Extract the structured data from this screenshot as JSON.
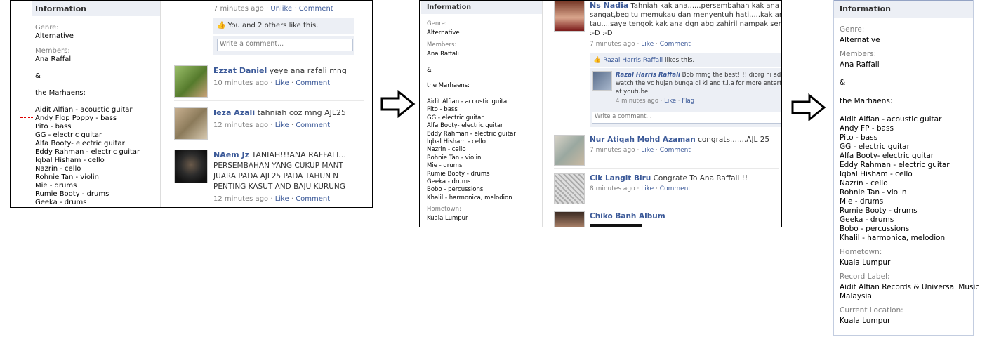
{
  "panel1": {
    "sidebar": {
      "header": "Information",
      "genre_label": "Genre:",
      "genre_value": "Alternative",
      "members_label": "Members:",
      "members_value": "Ana Raffali",
      "ampersand": "&",
      "marhaens": "the Marhaens:",
      "members": [
        "Aidit Alfian - acoustic guitar",
        "Andy Flop Poppy - bass",
        "Pito - bass",
        "GG - electric guitar",
        "Alfa Booty- electric guitar",
        "Eddy Rahman - electric guitar",
        "Iqbal Hisham - cello",
        "Nazrin - cello",
        "Rohnie Tan - violin",
        "Mie - drums",
        "Rumie Booty - drums",
        "Geeka - drums"
      ]
    },
    "feed": {
      "top_time": "7 minutes ago",
      "top_unlike": "Unlike",
      "top_comment": "Comment",
      "likes": "You and 2 others like this.",
      "write_comment": "Write a comment...",
      "posts": [
        {
          "name": "Ezzat Daniel",
          "text": "yeye ana rafali mng",
          "time": "10 minutes ago",
          "like": "Like",
          "comment": "Comment"
        },
        {
          "name": "Ieza Azali",
          "text": "tahniah coz mng AJL25",
          "time": "12 minutes ago",
          "like": "Like",
          "comment": "Comment"
        },
        {
          "name": "NAem Jz",
          "text": "TANIAH!!!ANA RAFFALI...",
          "text2": "PERSEMBAHAN YANG CUKUP MANT",
          "text3": "JUARA PADA AJL25 PADA TAHUN N",
          "text4": "PENTING KASUT AND BAJU KURUNG",
          "time": "12 minutes ago",
          "like": "Like",
          "comment": "Comment"
        }
      ]
    }
  },
  "panel2": {
    "sidebar": {
      "header": "Information",
      "genre_label": "Genre:",
      "genre_value": "Alternative",
      "members_label": "Members:",
      "members_value": "Ana Raffali",
      "ampersand": "&",
      "marhaens": "the Marhaens:",
      "members": [
        "Aidit Alfian - acoustic guitar",
        "Pito - bass",
        "GG - electric guitar",
        "Alfa Booty- electric guitar",
        "Eddy Rahman - electric guitar",
        "Iqbal Hisham - cello",
        "Nazrin - cello",
        "Rohnie Tan - violin",
        "Mie - drums",
        "Rumie Booty - drums",
        "Geeka - drums",
        "Bobo - percussions",
        "Khalil - harmonica, melodion"
      ],
      "hometown_label": "Hometown:",
      "hometown_value": "Kuala Lumpur"
    },
    "feed": {
      "post1_name": "Ns Nadia",
      "post1_l1": "Tahniah kak ana......persembahan kak ana m",
      "post1_l2": "sangat,begitu memukau dan menyentuh hati.....kak an",
      "post1_l3": "tau....saye tengok kak ana dgn abg zahiril nampak sera",
      "post1_l4": ":-D :-D",
      "post1_time": "7 minutes ago",
      "post1_like": "Like",
      "post1_comment": "Comment",
      "likes_name": "Razal Harris Raffali",
      "likes_text": "likes this.",
      "reply_name": "Razal Harris Raffali",
      "reply_l1": "Bob mmg the best!!!! diorg ni ade c",
      "reply_l2": "watch the vc hujan bunga di kl and t.i.a for more entertai",
      "reply_l3": "at youtube",
      "reply_time": "4 minutes ago",
      "reply_like": "Like",
      "reply_flag": "Flag",
      "write_comment": "Write a comment...",
      "post2_name": "Nur Atiqah Mohd Azaman",
      "post2_text": "congrats.......AJL 25",
      "post2_time": "7 minutes ago",
      "post2_like": "Like",
      "post2_comment": "Comment",
      "post3_name": "Cik Langit Biru",
      "post3_text": "Congrate To Ana Raffali !!",
      "post3_time": "8 minutes ago",
      "post3_like": "Like",
      "post3_comment": "Comment",
      "post4_name": "Chiko Banh Album"
    }
  },
  "panel3": {
    "header": "Information",
    "genre_label": "Genre:",
    "genre_value": "Alternative",
    "members_label": "Members:",
    "members_value": "Ana Raffali",
    "ampersand": "&",
    "marhaens": "the Marhaens:",
    "members": [
      "Aidit Alfian - acoustic guitar",
      "Andy FP - bass",
      "Pito - bass",
      "GG - electric guitar",
      "Alfa Booty- electric guitar",
      "Eddy Rahman - electric guitar",
      "Iqbal Hisham - cello",
      "Nazrin - cello",
      "Rohnie Tan - violin",
      "Mie - drums",
      "Rumie Booty - drums",
      "Geeka - drums",
      "Bobo - percussions",
      "Khalil - harmonica, melodion"
    ],
    "hometown_label": "Hometown:",
    "hometown_value": "Kuala Lumpur",
    "record_label": "Record Label:",
    "record_value1": "Aidit Alfian Records & Universal Music",
    "record_value2": "Malaysia",
    "location_label": "Current Location:",
    "location_value": "Kuala Lumpur"
  }
}
